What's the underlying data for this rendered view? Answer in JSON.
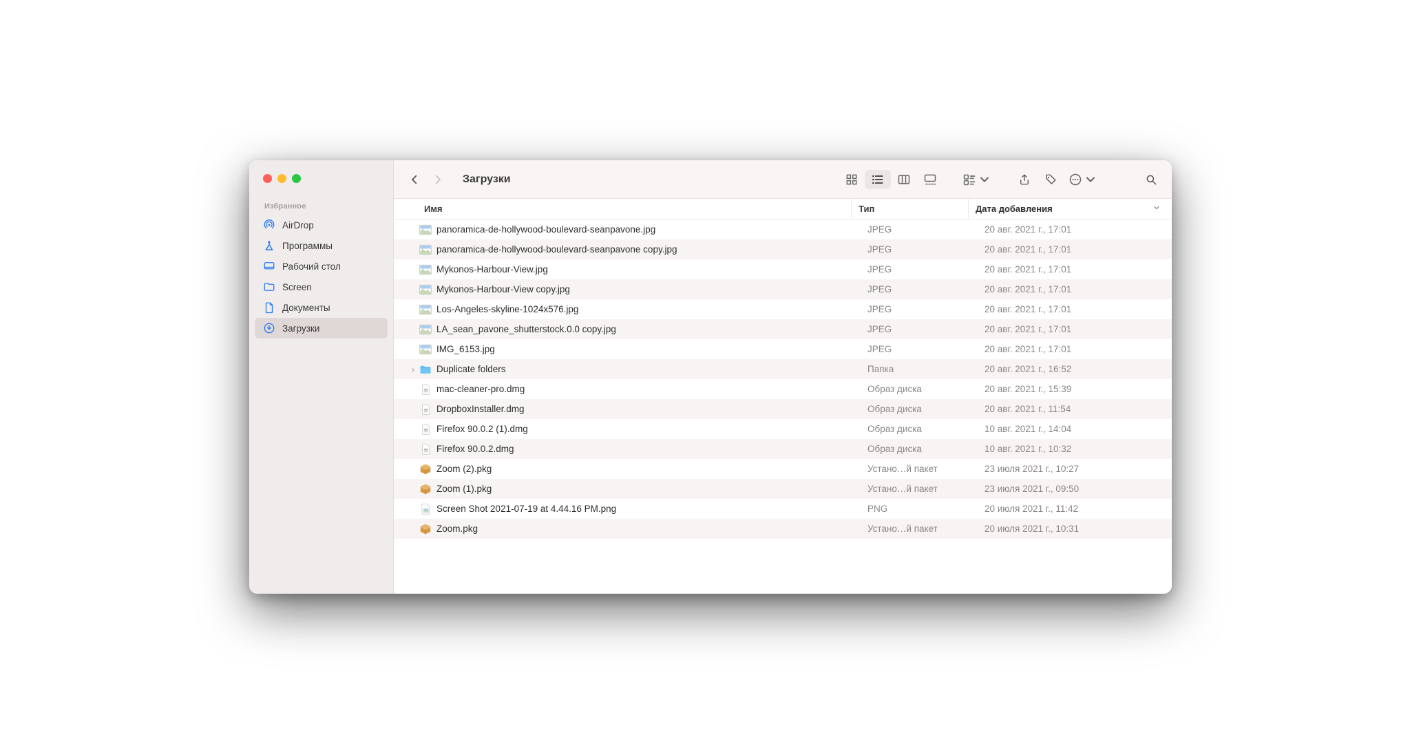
{
  "sidebar": {
    "heading": "Избранное",
    "items": [
      {
        "label": "AirDrop",
        "icon": "i-airdrop",
        "selected": false
      },
      {
        "label": "Программы",
        "icon": "i-apps",
        "selected": false
      },
      {
        "label": "Рабочий стол",
        "icon": "i-desktop",
        "selected": false
      },
      {
        "label": "Screen",
        "icon": "i-folder-s",
        "selected": false
      },
      {
        "label": "Документы",
        "icon": "i-doc",
        "selected": false
      },
      {
        "label": "Загрузки",
        "icon": "i-download",
        "selected": true
      }
    ]
  },
  "toolbar": {
    "title": "Загрузки"
  },
  "columns": {
    "name": "Имя",
    "type": "Тип",
    "date": "Дата добавления"
  },
  "files": [
    {
      "name": "panoramica-de-hollywood-boulevard-seanpavone.jpg",
      "type": "JPEG",
      "date": "20 авг. 2021 г., 17:01",
      "icon": "ft-image",
      "expand": false
    },
    {
      "name": "panoramica-de-hollywood-boulevard-seanpavone copy.jpg",
      "type": "JPEG",
      "date": "20 авг. 2021 г., 17:01",
      "icon": "ft-image",
      "expand": false
    },
    {
      "name": "Mykonos-Harbour-View.jpg",
      "type": "JPEG",
      "date": "20 авг. 2021 г., 17:01",
      "icon": "ft-image",
      "expand": false
    },
    {
      "name": "Mykonos-Harbour-View copy.jpg",
      "type": "JPEG",
      "date": "20 авг. 2021 г., 17:01",
      "icon": "ft-image",
      "expand": false
    },
    {
      "name": "Los-Angeles-skyline-1024x576.jpg",
      "type": "JPEG",
      "date": "20 авг. 2021 г., 17:01",
      "icon": "ft-image",
      "expand": false
    },
    {
      "name": "LA_sean_pavone_shutterstock.0.0 copy.jpg",
      "type": "JPEG",
      "date": "20 авг. 2021 г., 17:01",
      "icon": "ft-image",
      "expand": false
    },
    {
      "name": "IMG_6153.jpg",
      "type": "JPEG",
      "date": "20 авг. 2021 г., 17:01",
      "icon": "ft-image",
      "expand": false
    },
    {
      "name": "Duplicate folders",
      "type": "Папка",
      "date": "20 авг. 2021 г., 16:52",
      "icon": "ft-folder",
      "expand": true
    },
    {
      "name": "mac-cleaner-pro.dmg",
      "type": "Образ диска",
      "date": "20 авг. 2021 г., 15:39",
      "icon": "ft-dmg",
      "expand": false
    },
    {
      "name": "DropboxInstaller.dmg",
      "type": "Образ диска",
      "date": "20 авг. 2021 г., 11:54",
      "icon": "ft-dmg",
      "expand": false
    },
    {
      "name": "Firefox 90.0.2 (1).dmg",
      "type": "Образ диска",
      "date": "10 авг. 2021 г., 14:04",
      "icon": "ft-dmg",
      "expand": false
    },
    {
      "name": "Firefox 90.0.2.dmg",
      "type": "Образ диска",
      "date": "10 авг. 2021 г., 10:32",
      "icon": "ft-dmg",
      "expand": false
    },
    {
      "name": "Zoom (2).pkg",
      "type": "Устано…й пакет",
      "date": "23 июля 2021 г., 10:27",
      "icon": "ft-pkg",
      "expand": false
    },
    {
      "name": "Zoom (1).pkg",
      "type": "Устано…й пакет",
      "date": "23 июля 2021 г., 09:50",
      "icon": "ft-pkg",
      "expand": false
    },
    {
      "name": "Screen Shot 2021-07-19 at 4.44.16 PM.png",
      "type": "PNG",
      "date": "20 июля 2021 г., 11:42",
      "icon": "ft-png",
      "expand": false
    },
    {
      "name": "Zoom.pkg",
      "type": "Устано…й пакет",
      "date": "20 июля 2021 г., 10:31",
      "icon": "ft-pkg",
      "expand": false
    }
  ]
}
